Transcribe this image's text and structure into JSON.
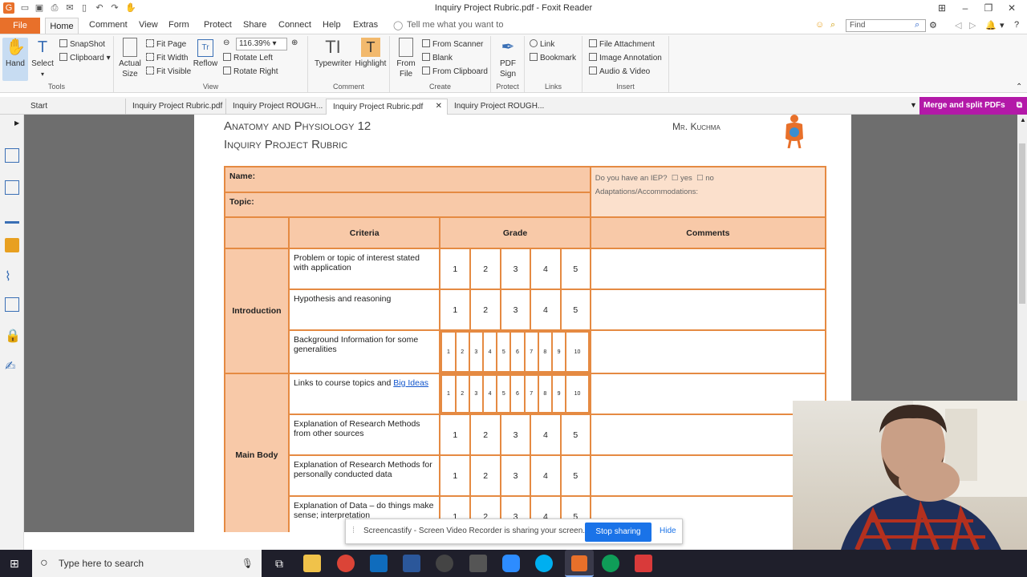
{
  "window": {
    "title": "Inquiry Project Rubric.pdf - Foxit Reader"
  },
  "menu": {
    "file": "File",
    "items": [
      "Home",
      "Comment",
      "View",
      "Form",
      "Protect",
      "Share",
      "Connect",
      "Help",
      "Extras"
    ],
    "tell_me": "Tell me what you want to",
    "find_placeholder": "Find"
  },
  "ribbon": {
    "tools": {
      "hand": "Hand",
      "select": "Select",
      "snapshot": "SnapShot",
      "clipboard": "Clipboard",
      "label": "Tools"
    },
    "view": {
      "actual_size": "Actual Size",
      "fit_page": "Fit Page",
      "fit_width": "Fit Width",
      "fit_visible": "Fit Visible",
      "reflow": "Reflow",
      "zoom": "116.39%",
      "rotate_left": "Rotate Left",
      "rotate_right": "Rotate Right",
      "label": "View"
    },
    "comment": {
      "typewriter": "Typewriter",
      "highlight": "Highlight",
      "label": "Comment"
    },
    "create": {
      "from_file": "From File",
      "from_scanner": "From Scanner",
      "blank": "Blank",
      "from_clipboard": "From Clipboard",
      "label": "Create"
    },
    "protect": {
      "pdf_sign": "PDF Sign",
      "label": "Protect"
    },
    "links": {
      "link": "Link",
      "bookmark": "Bookmark",
      "label": "Links"
    },
    "insert": {
      "file_attachment": "File Attachment",
      "image_annotation": "Image Annotation",
      "audio_video": "Audio & Video",
      "label": "Insert"
    }
  },
  "doc_tabs": [
    "Start",
    "Inquiry Project Rubric.pdf",
    "Inquiry Project ROUGH...",
    "Inquiry Project Rubric.pdf",
    "Inquiry Project ROUGH..."
  ],
  "merge_button": "Merge and split PDFs",
  "document": {
    "course": "Anatomy and Physiology 12",
    "subtitle": "Inquiry Project Rubric",
    "teacher": "Mr. Kuchma",
    "name_label": "Name:",
    "topic_label": "Topic:",
    "iep_question": "Do you have an IEP?",
    "iep_yes": "yes",
    "iep_no": "no",
    "adaptations": "Adaptations/Accommodations:",
    "headers": {
      "criteria": "Criteria",
      "grade": "Grade",
      "comments": "Comments"
    },
    "sections": {
      "intro": "Introduction",
      "body": "Main Body"
    },
    "criteria": {
      "c1": "Problem or topic of interest stated with application",
      "c2": "Hypothesis and reasoning",
      "c3": "Background Information for some generalities",
      "c4a": "Links to course topics and ",
      "c4b": "Big Ideas",
      "c5": "Explanation of Research Methods from other sources",
      "c6": "Explanation of Research Methods for personally conducted data",
      "c7": "Explanation of Data – do things make sense; interpretation"
    },
    "scale5": [
      "1",
      "2",
      "3",
      "4",
      "5"
    ],
    "scale10": [
      "1",
      "2",
      "3",
      "4",
      "5",
      "6",
      "7",
      "8",
      "9",
      "10"
    ]
  },
  "screencastify": {
    "message": "Screencastify - Screen Video Recorder is sharing your screen.",
    "stop": "Stop sharing",
    "hide": "Hide"
  },
  "taskbar": {
    "search": "Type here to search"
  }
}
